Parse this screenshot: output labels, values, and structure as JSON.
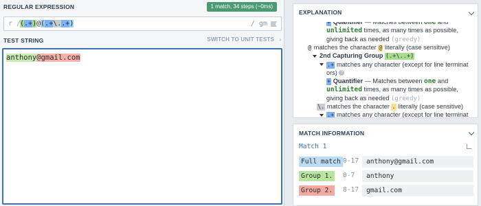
{
  "regex": {
    "section_title": "REGULAR EXPRESSION",
    "match_badge": "1 match, 34 steps (~0ms)",
    "prefix": "r /",
    "pattern_tokens": [
      {
        "text": "(",
        "cls": "tok-g1"
      },
      {
        "text": ".+",
        "cls": "tok-dot"
      },
      {
        "text": ")",
        "cls": "tok-g1"
      },
      {
        "text": "@",
        "cls": ""
      },
      {
        "text": "(",
        "cls": "tok-g2"
      },
      {
        "text": ".+",
        "cls": "tok-dot"
      },
      {
        "text": "\\.",
        "cls": "tok-esc"
      },
      {
        "text": ".+",
        "cls": "tok-dot"
      },
      {
        "text": ")",
        "cls": "tok-g2"
      }
    ],
    "flags": "/ gm"
  },
  "test": {
    "section_title": "TEST STRING",
    "switch_label": "SWITCH TO UNIT TESTS",
    "switch_icon": "›",
    "text_segments": [
      {
        "text": "anthony",
        "cls": "m-g1"
      },
      {
        "text": "@",
        "cls": "m-at"
      },
      {
        "text": "gmail.com",
        "cls": "m-g2"
      }
    ]
  },
  "explanation": {
    "title": "EXPLANATION",
    "lines": [
      {
        "indent": 48,
        "html": "<span class='ch-bg tok-dot' style='background:#7fb2f4'>+</span> <b>Quantifier</b> — Matches between <span class='kw'>one</span> and"
      },
      {
        "indent": 48,
        "html": "<span class='kw'>unlimited</span> times, as many times as possible,"
      },
      {
        "indent": 48,
        "html": "giving back as needed <span class='greedy'>(greedy)</span>"
      },
      {
        "indent": 20,
        "html": "<span class='ch-bg' style='background:#f4f6f8'>@</span> matches the character <span class='ch-bg' style='background:#ffe08a'>@</span> literally (case sensitive)"
      },
      {
        "indent": 28,
        "html": "<span class='bullet'></span><b>2nd Capturing Group</b> <span class='ch-bg' style='background:#a8dc8e'>(.+\\..+)</span>"
      },
      {
        "indent": 38,
        "html": "<span class='bullet'></span><span class='ch-bg' style='background:#7fb2f4'>.+</span> matches any character (except for line terminat"
      },
      {
        "indent": 48,
        "html": "ors) <span class='q-icon'>?</span>"
      },
      {
        "indent": 48,
        "html": "<span class='ch-bg' style='background:#7fb2f4'>+</span> <b>Quantifier</b> — Matches between <span class='kw'>one</span> and"
      },
      {
        "indent": 48,
        "html": "<span class='kw'>unlimited</span> times, as many times as possible,"
      },
      {
        "indent": 48,
        "html": "giving back as needed <span class='greedy'>(greedy)</span>"
      },
      {
        "indent": 34,
        "html": "<span class='ch-bg' style='background:#c9cdd2'>\\.</span> matches the character <span class='ch-bg' style='background:#ffe08a'>.</span> literally (case sensitive)"
      },
      {
        "indent": 38,
        "html": "<span class='bullet'></span><span class='ch-bg' style='background:#7fb2f4'>.+</span> matches any character (except for line terminat"
      }
    ]
  },
  "match_info": {
    "title": "MATCH INFORMATION",
    "match_label": "Match 1",
    "rows": [
      {
        "tag": "Full match",
        "range": "0-17",
        "value": "anthony@gmail.com",
        "tag_color": "#bcdcf5"
      },
      {
        "tag": "Group 1.",
        "range": "0-7",
        "value": "anthony",
        "tag_color": "#b8e6a0"
      },
      {
        "tag": "Group 2.",
        "range": "8-17",
        "value": "gmail.com",
        "tag_color": "#f4aaa2"
      }
    ]
  }
}
